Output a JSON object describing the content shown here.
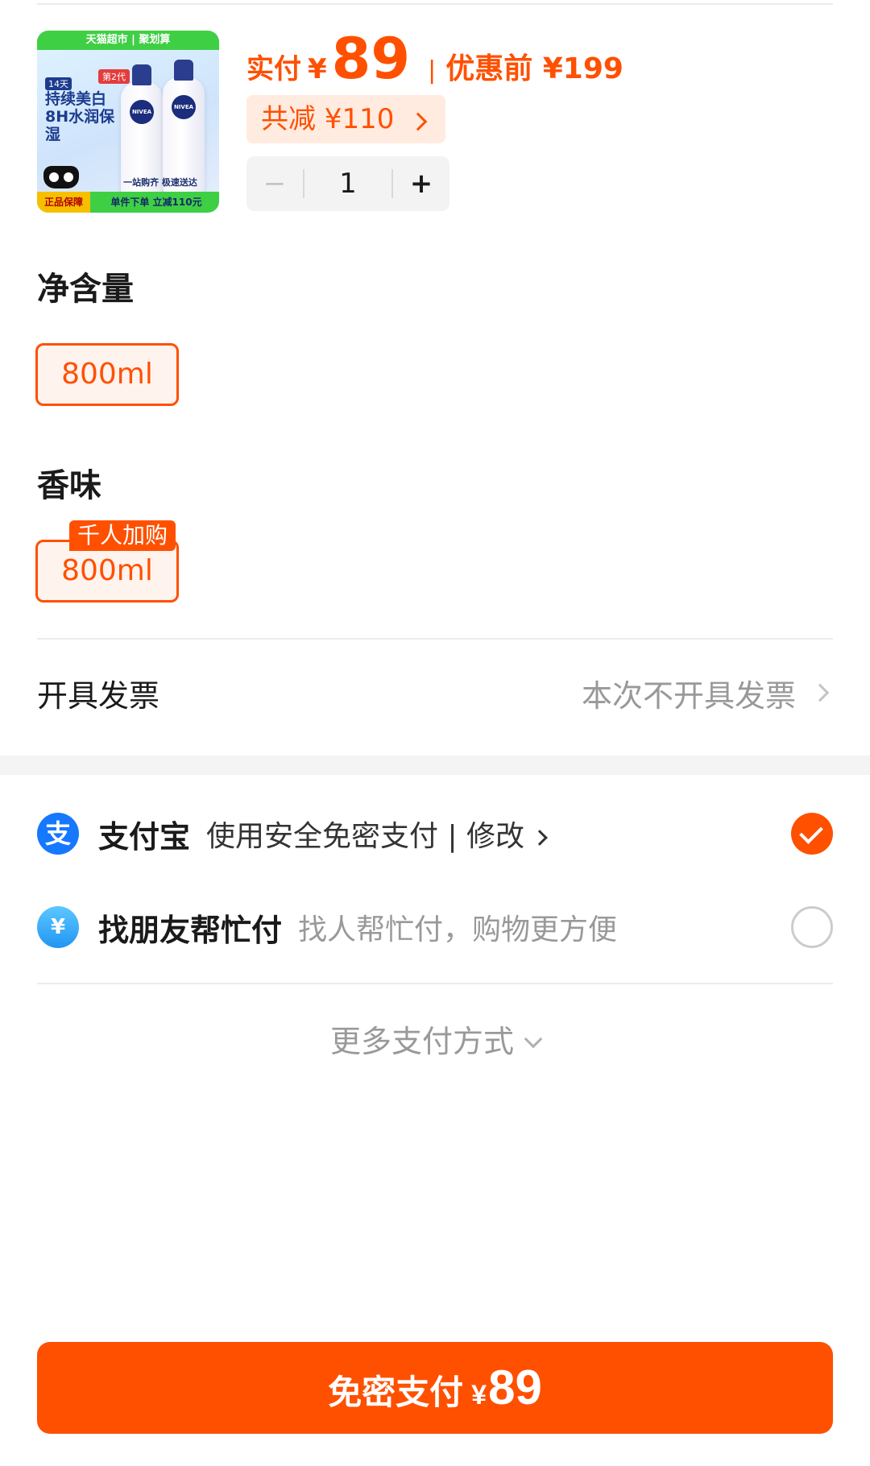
{
  "product": {
    "image": {
      "top_band": "天猫超市 | 聚划算",
      "generation_badge": "第2代",
      "days_badge": "14天",
      "claim": "持续美白 8H水润保湿",
      "brand_on_bottle": "NIVEA",
      "guarantee": "正品保障",
      "promo_line_1": "一站购齐 极速送达",
      "promo_line_2": "单件下单 立减110元"
    },
    "price_label": "实付",
    "currency": "¥",
    "price": "89",
    "separator": "|",
    "original_price_text": "优惠前 ¥199",
    "saving_text": "共减 ¥110",
    "quantity": {
      "minus": "−",
      "value": "1",
      "plus": "+"
    }
  },
  "specs": [
    {
      "title": "净含量",
      "option": "800ml"
    },
    {
      "title": "香味",
      "option": "800ml",
      "badge": "千人加购"
    }
  ],
  "invoice": {
    "label": "开具发票",
    "value": "本次不开具发票"
  },
  "payment": {
    "methods": [
      {
        "name": "支付宝",
        "icon": "alipay-icon",
        "icon_glyph": "支",
        "description": "使用安全免密支付 | 修改",
        "selected": true
      },
      {
        "name": "找朋友帮忙付",
        "icon": "friend-pay-icon",
        "icon_glyph": "¥",
        "description": "找人帮忙付，购物更方便",
        "selected": false
      }
    ],
    "more_methods": "更多支付方式"
  },
  "submit": {
    "label": "免密支付",
    "currency": "¥",
    "amount": "89"
  },
  "colors": {
    "accent": "#ff5000",
    "accent_light": "#ffebe0",
    "alipay_blue": "#1677ff",
    "muted_text": "#999999"
  }
}
